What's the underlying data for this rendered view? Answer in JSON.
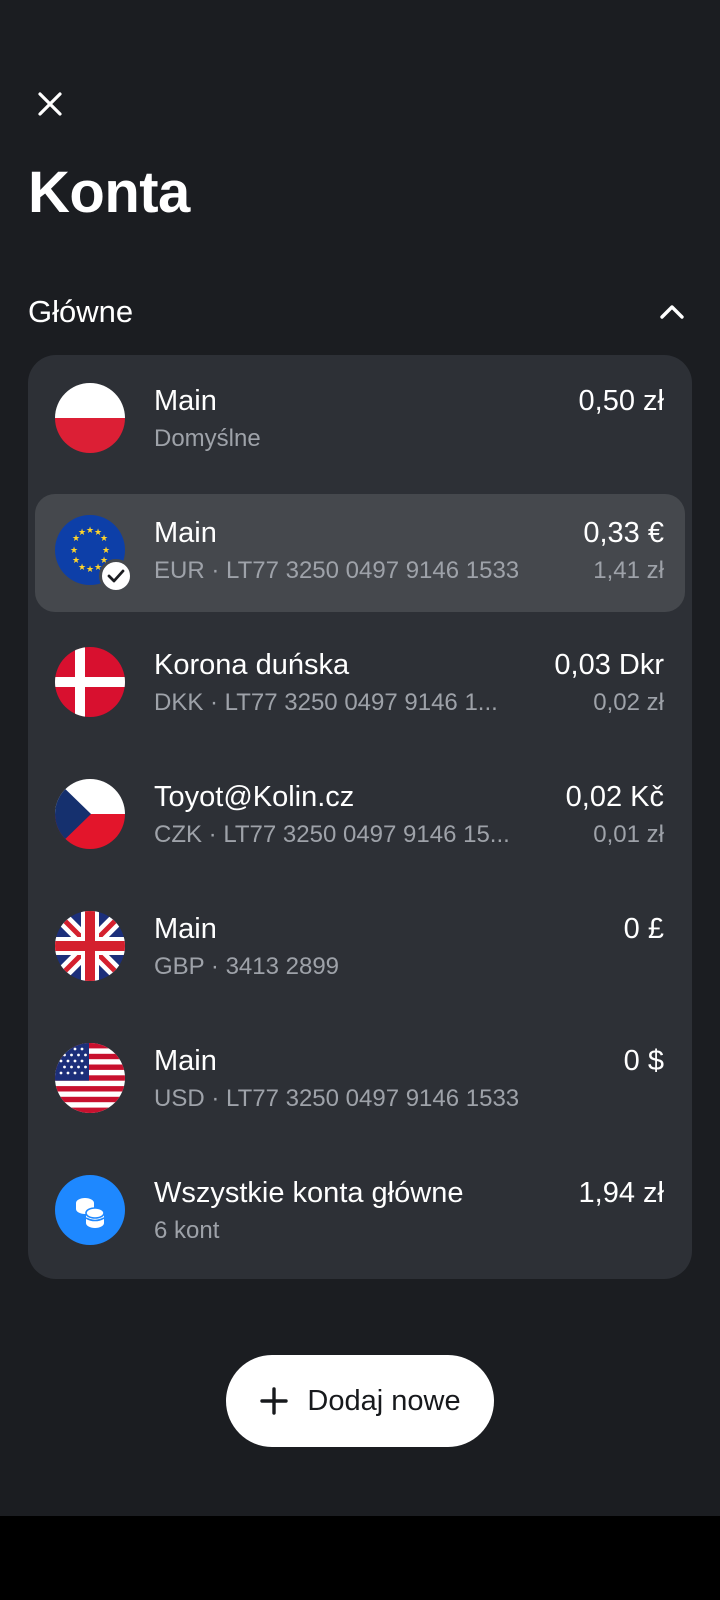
{
  "header": {
    "close_icon": "close-icon",
    "title": "Konta"
  },
  "section": {
    "title": "Główne",
    "toggle_icon": "chevron-up-icon"
  },
  "accounts": [
    {
      "flag": "poland-flag-icon",
      "name": "Main",
      "sub": "Domyślne",
      "amount": "0,50 zł",
      "amount2": "",
      "selected": false
    },
    {
      "flag": "eu-flag-icon",
      "name": "Main",
      "sub": "EUR · LT77 3250 0497 9146 1533",
      "amount": "0,33 €",
      "amount2": "1,41 zł",
      "selected": true
    },
    {
      "flag": "denmark-flag-icon",
      "name": "Korona duńska",
      "sub": "DKK · LT77 3250 0497 9146 1...",
      "amount": "0,03 Dkr",
      "amount2": "0,02 zł",
      "selected": false
    },
    {
      "flag": "czech-flag-icon",
      "name": "Toyot@Kolin.cz",
      "sub": "CZK · LT77 3250 0497 9146 15...",
      "amount": "0,02 Kč",
      "amount2": "0,01 zł",
      "selected": false
    },
    {
      "flag": "uk-flag-icon",
      "name": "Main",
      "sub": "GBP · 3413 2899",
      "amount": "0 £",
      "amount2": "",
      "selected": false
    },
    {
      "flag": "usa-flag-icon",
      "name": "Main",
      "sub": "USD · LT77 3250 0497 9146 1533",
      "amount": "0 $",
      "amount2": "",
      "selected": false
    },
    {
      "flag": "coins-icon",
      "name": "Wszystkie konta główne",
      "sub": "6 kont",
      "amount": "1,94 zł",
      "amount2": "",
      "selected": false
    }
  ],
  "add_button": {
    "label": "Dodaj nowe",
    "icon": "plus-icon"
  },
  "colors": {
    "background": "#1b1d21",
    "card": "#2d3036",
    "selected": "#45484d",
    "accent_blue": "#1e88ff",
    "muted_text": "#9ea2a9"
  }
}
